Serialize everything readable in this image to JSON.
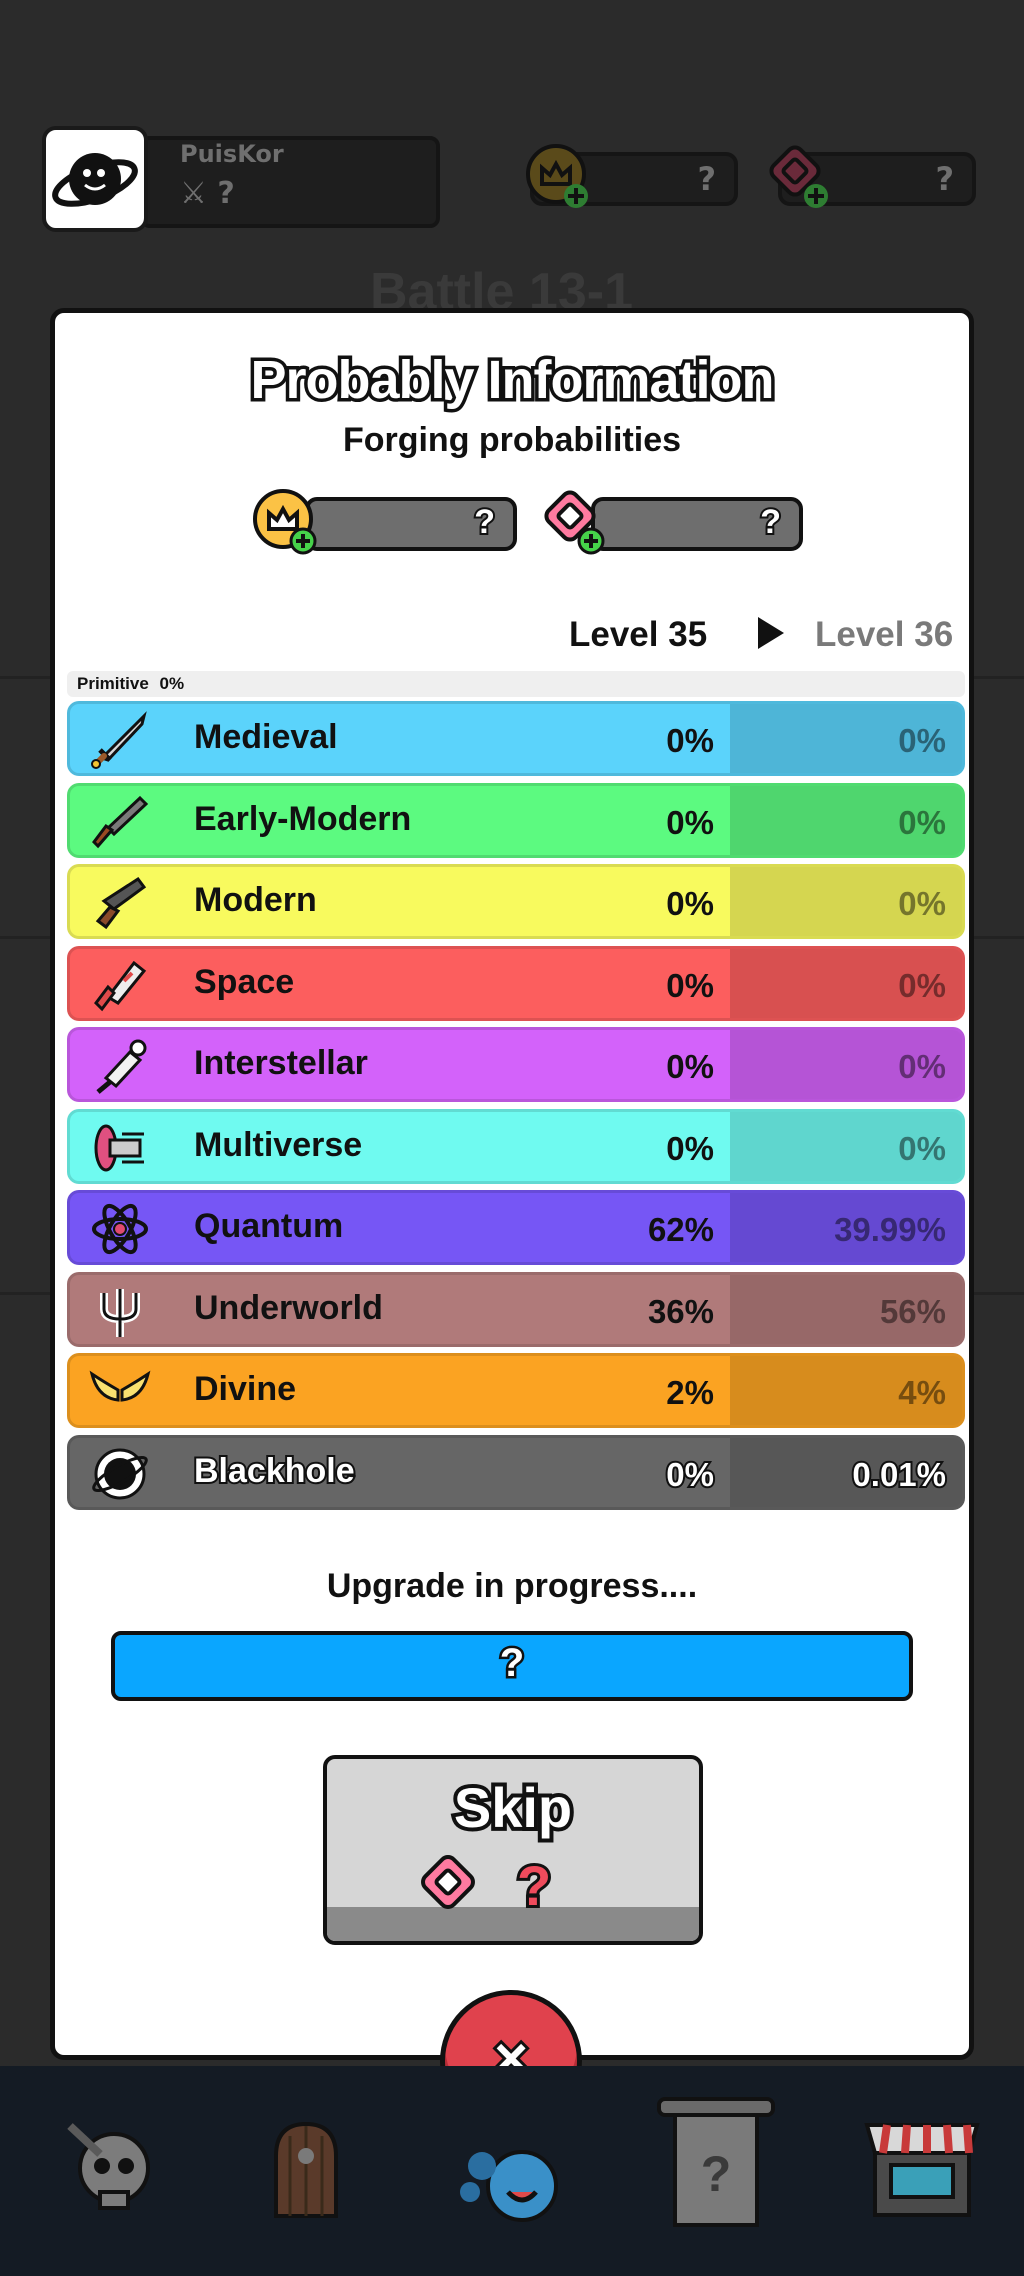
{
  "player": {
    "name": "PuisKor",
    "power": "?"
  },
  "resources": {
    "crown": "?",
    "gem": "?"
  },
  "battle": {
    "title": "Battle 13-1"
  },
  "modal": {
    "title": "Probably Information",
    "subtitle": "Forging probabilities",
    "crown_value": "?",
    "gem_value": "?",
    "level_current": "Level 35",
    "level_next": "Level 36",
    "primitive_label": "Primitive",
    "primitive_value": "0%",
    "tiers": [
      {
        "name": "Medieval",
        "current": "0%",
        "next": "0%",
        "color": "#5bd3fb",
        "icon": "sword-icon"
      },
      {
        "name": "Early-Modern",
        "current": "0%",
        "next": "0%",
        "color": "#5cfa80",
        "icon": "musket-icon"
      },
      {
        "name": "Modern",
        "current": "0%",
        "next": "0%",
        "color": "#f8fa5e",
        "icon": "pistol-icon"
      },
      {
        "name": "Space",
        "current": "0%",
        "next": "0%",
        "color": "#fc5e5e",
        "icon": "blaster-icon"
      },
      {
        "name": "Interstellar",
        "current": "0%",
        "next": "0%",
        "color": "#d362fa",
        "icon": "raygun-icon"
      },
      {
        "name": "Multiverse",
        "current": "0%",
        "next": "0%",
        "color": "#6ffaf0",
        "icon": "portal-gun-icon"
      },
      {
        "name": "Quantum",
        "current": "62%",
        "next": "39.99%",
        "color": "#7656f5",
        "icon": "atom-icon"
      },
      {
        "name": "Underworld",
        "current": "36%",
        "next": "56%",
        "color": "#b07a7a",
        "icon": "trident-icon"
      },
      {
        "name": "Divine",
        "current": "2%",
        "next": "4%",
        "color": "#fba322",
        "icon": "wings-icon"
      },
      {
        "name": "Blackhole",
        "current": "0%",
        "next": "0.01%",
        "color": "#666666",
        "icon": "blackhole-icon"
      }
    ],
    "upgrade_label": "Upgrade in progress....",
    "upgrade_value": "?",
    "skip_label": "Skip",
    "skip_cost": "?",
    "close_label": "×"
  },
  "nav": [
    {
      "icon": "skull-icon"
    },
    {
      "icon": "dungeon-door-icon"
    },
    {
      "icon": "forge-icon"
    },
    {
      "icon": "scroll-icon"
    },
    {
      "icon": "shop-icon"
    }
  ]
}
